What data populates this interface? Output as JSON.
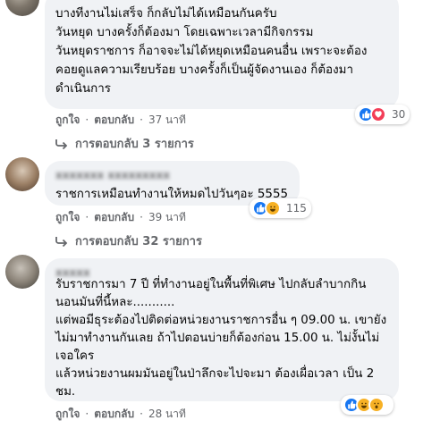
{
  "comments": [
    {
      "author": "xxxxxxx xxxx",
      "text_lines": [
        "บางทีงานไม่เสร็จ ก็กลับไม่ได้เหมือนกันครับ",
        "วันหยุด บางครั้งก็ต้องมา โดยเฉพาะเวลามีกิจกรรม",
        "วันหยุดราชการ ก็อาจจะไม่ได้หยุดเหมือนคนอื่น เพราะจะต้อง",
        "คอยดูแลความเรียบร้อย บางครั้งก็เป็นผู้จัดงานเอง ก็ต้องมา",
        "ดำเนินการ"
      ],
      "like_label": "ถูกใจ",
      "reply_label": "ตอบกลับ",
      "time": "37 นาที",
      "reaction_icons": [
        "like-icon",
        "love-icon"
      ],
      "reaction_count": "30",
      "replies_label": "การตอบกลับ 3 รายการ"
    },
    {
      "author": "xxxxxxx xxxxxxxxx",
      "text_lines": [
        "ราชการเหมือนทำงานให้หมดไปวันๆอะ 5555"
      ],
      "like_label": "ถูกใจ",
      "reply_label": "ตอบกลับ",
      "time": "39 นาที",
      "reaction_icons": [
        "like-icon",
        "haha-icon"
      ],
      "reaction_count": "115",
      "replies_label": "การตอบกลับ 32 รายการ"
    },
    {
      "author": "xxxxx",
      "text_lines": [
        "รับราชการมา 7 ปี ที่ทำงานอยู่ในพื้นที่พิเศษ ไปกลับลำบากกิน",
        "นอนมันที่นี้หละ...........",
        "แต่พอมีธุระต้องไปติดต่อหน่วยงานราชการอื่น ๆ 09.00 น. เขายัง",
        "ไม่มาทำงานกันเลย ถ้าไปตอนบ่ายก็ต้องก่อน 15.00 น. ไม่งั้นไม่",
        "เจอใคร",
        "แล้วหน่วยงานผมมันอยู่ในป่าลึกจะไปจะมา ต้องเผื่อเวลา เป็น 2",
        "ชม."
      ],
      "like_label": "ถูกใจ",
      "reply_label": "ตอบกลับ",
      "time": "28 นาที",
      "reaction_icons": [
        "like-icon",
        "haha-icon",
        "wow-icon"
      ],
      "reaction_count": "",
      "replies_label": ""
    }
  ],
  "colors": {
    "bubble": "#f0f2f5",
    "meta": "#65676b",
    "like": "#1877f2",
    "love": "#f33e58",
    "haha": "#f7b125"
  }
}
